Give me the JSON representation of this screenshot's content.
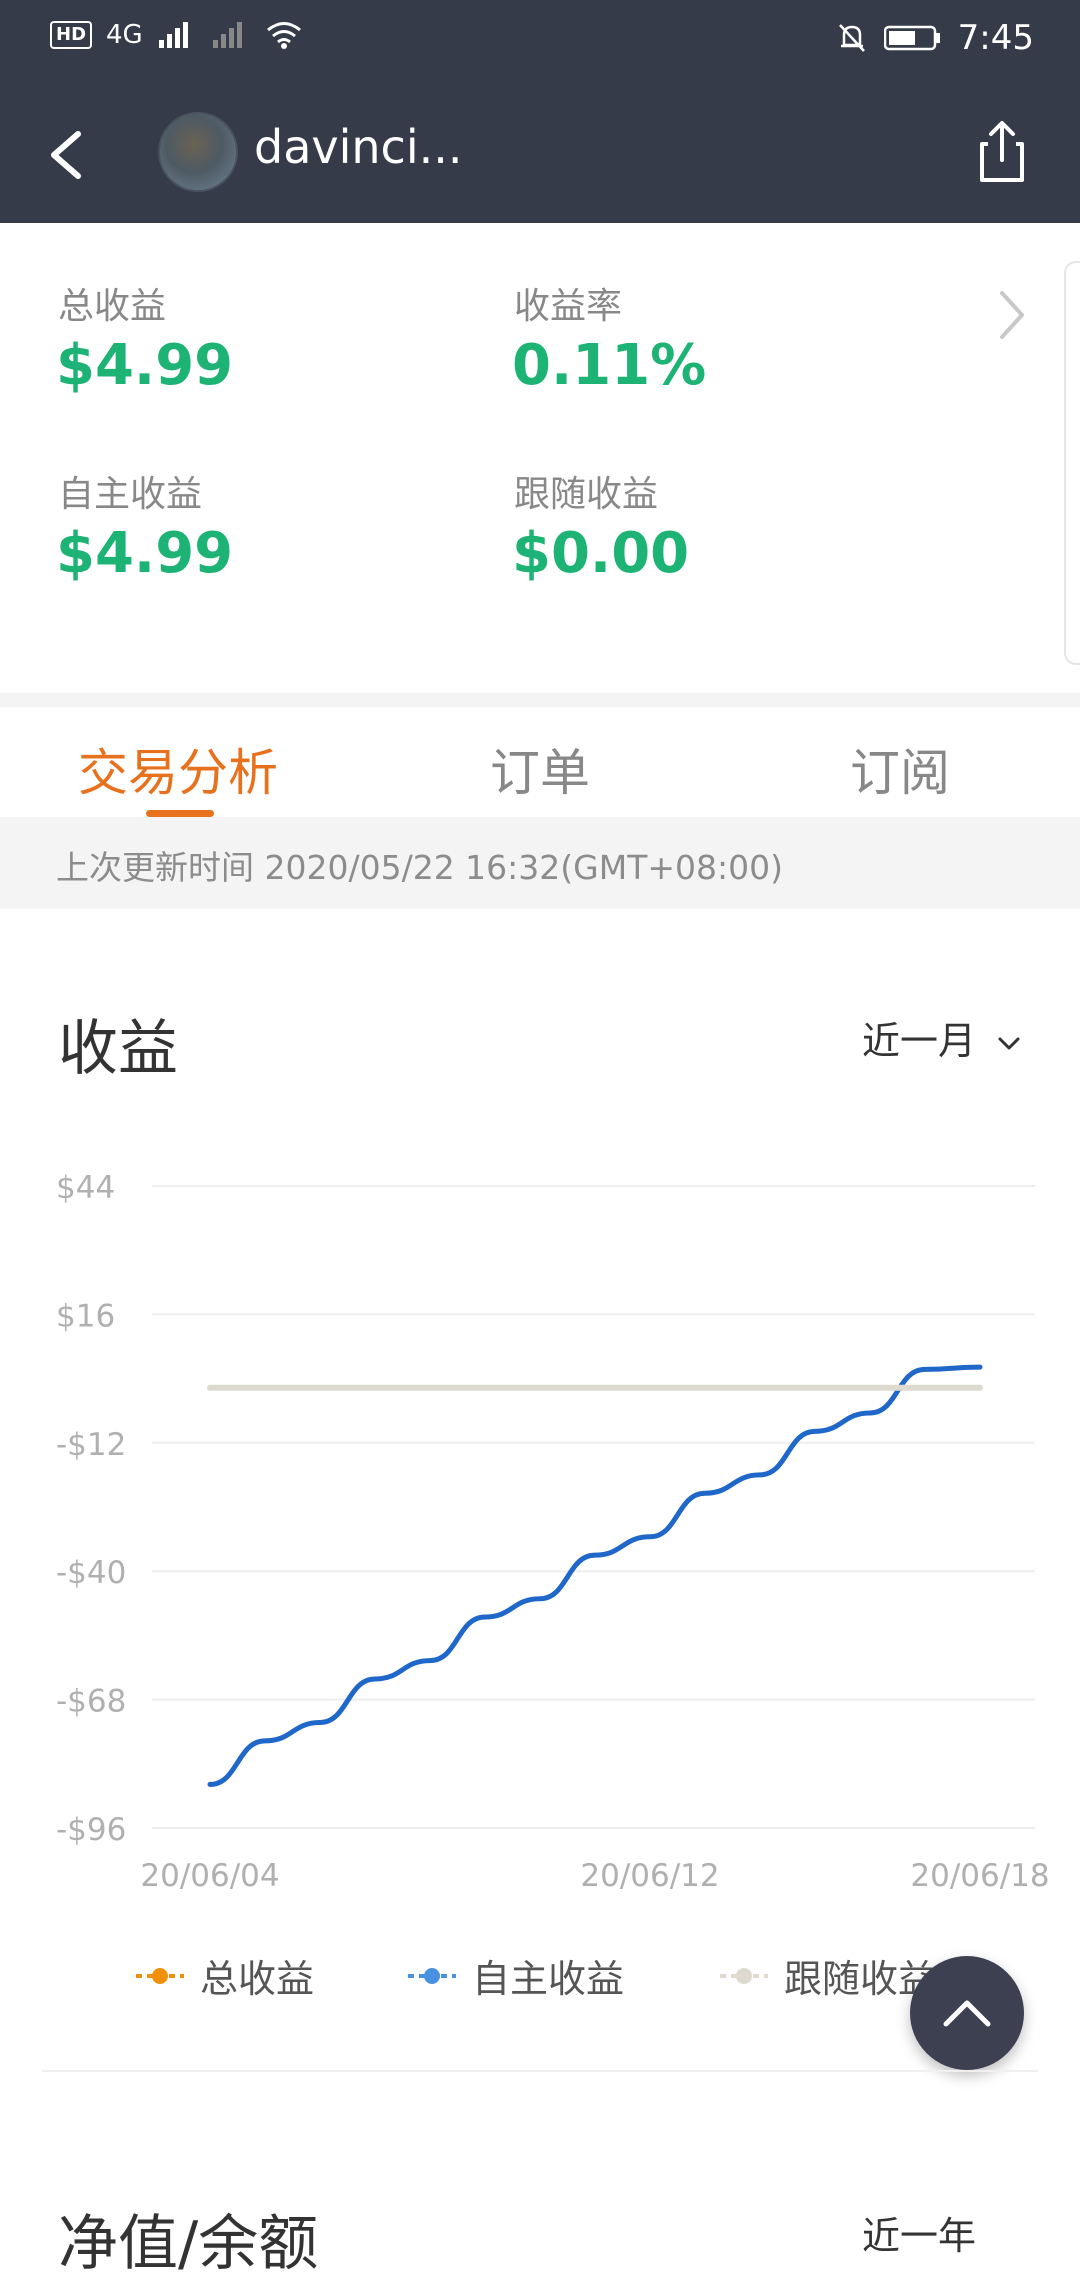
{
  "status_bar": {
    "network": "4G",
    "time": "7:45"
  },
  "header": {
    "username": "davinci..."
  },
  "summary": {
    "total_income_label": "总收益",
    "total_income_value": "$4.99",
    "return_rate_label": "收益率",
    "return_rate_value": "0.11%",
    "self_income_label": "自主收益",
    "self_income_value": "$4.99",
    "follow_income_label": "跟随收益",
    "follow_income_value": "$0.00"
  },
  "tabs": [
    {
      "label": "交易分析",
      "active": true
    },
    {
      "label": "订单",
      "active": false
    },
    {
      "label": "订阅",
      "active": false
    }
  ],
  "last_update": "上次更新时间 2020/05/22 16:32(GMT+08:00)",
  "income_section": {
    "title": "收益",
    "range": "近一月"
  },
  "chart_data": {
    "type": "line",
    "yticks": [
      "$44",
      "$16",
      "-$12",
      "-$40",
      "-$68",
      "-$96"
    ],
    "ytick_values": [
      44,
      16,
      -12,
      -40,
      -68,
      -96
    ],
    "xticks": [
      "20/06/04",
      "20/06/12",
      "20/06/18"
    ],
    "ylim": [
      -96,
      44
    ],
    "x_dates": [
      "20/06/04",
      "20/06/05",
      "20/06/06",
      "20/06/07",
      "20/06/08",
      "20/06/09",
      "20/06/10",
      "20/06/11",
      "20/06/12",
      "20/06/13",
      "20/06/14",
      "20/06/15",
      "20/06/16",
      "20/06/17",
      "20/06/18"
    ],
    "series": [
      {
        "name": "总收益",
        "color": "#f0900a",
        "values": []
      },
      {
        "name": "自主收益",
        "color": "#1f67c8",
        "values": [
          -86.5,
          -77.0,
          -73.0,
          -63.5,
          -59.5,
          -50.0,
          -46.0,
          -36.5,
          -32.5,
          -23.0,
          -19.0,
          -9.5,
          -5.5,
          4.0,
          4.5
        ]
      },
      {
        "name": "跟随收益",
        "color": "#dedad0",
        "values": [
          0,
          0,
          0,
          0,
          0,
          0,
          0,
          0,
          0,
          0,
          0,
          0,
          0,
          0,
          0
        ]
      }
    ]
  },
  "net_value_section": {
    "title": "净值/余额",
    "range": "近一年"
  },
  "colors": {
    "header_bg": "#353b48",
    "accent_orange": "#e8711d",
    "positive_green": "#1db374"
  }
}
